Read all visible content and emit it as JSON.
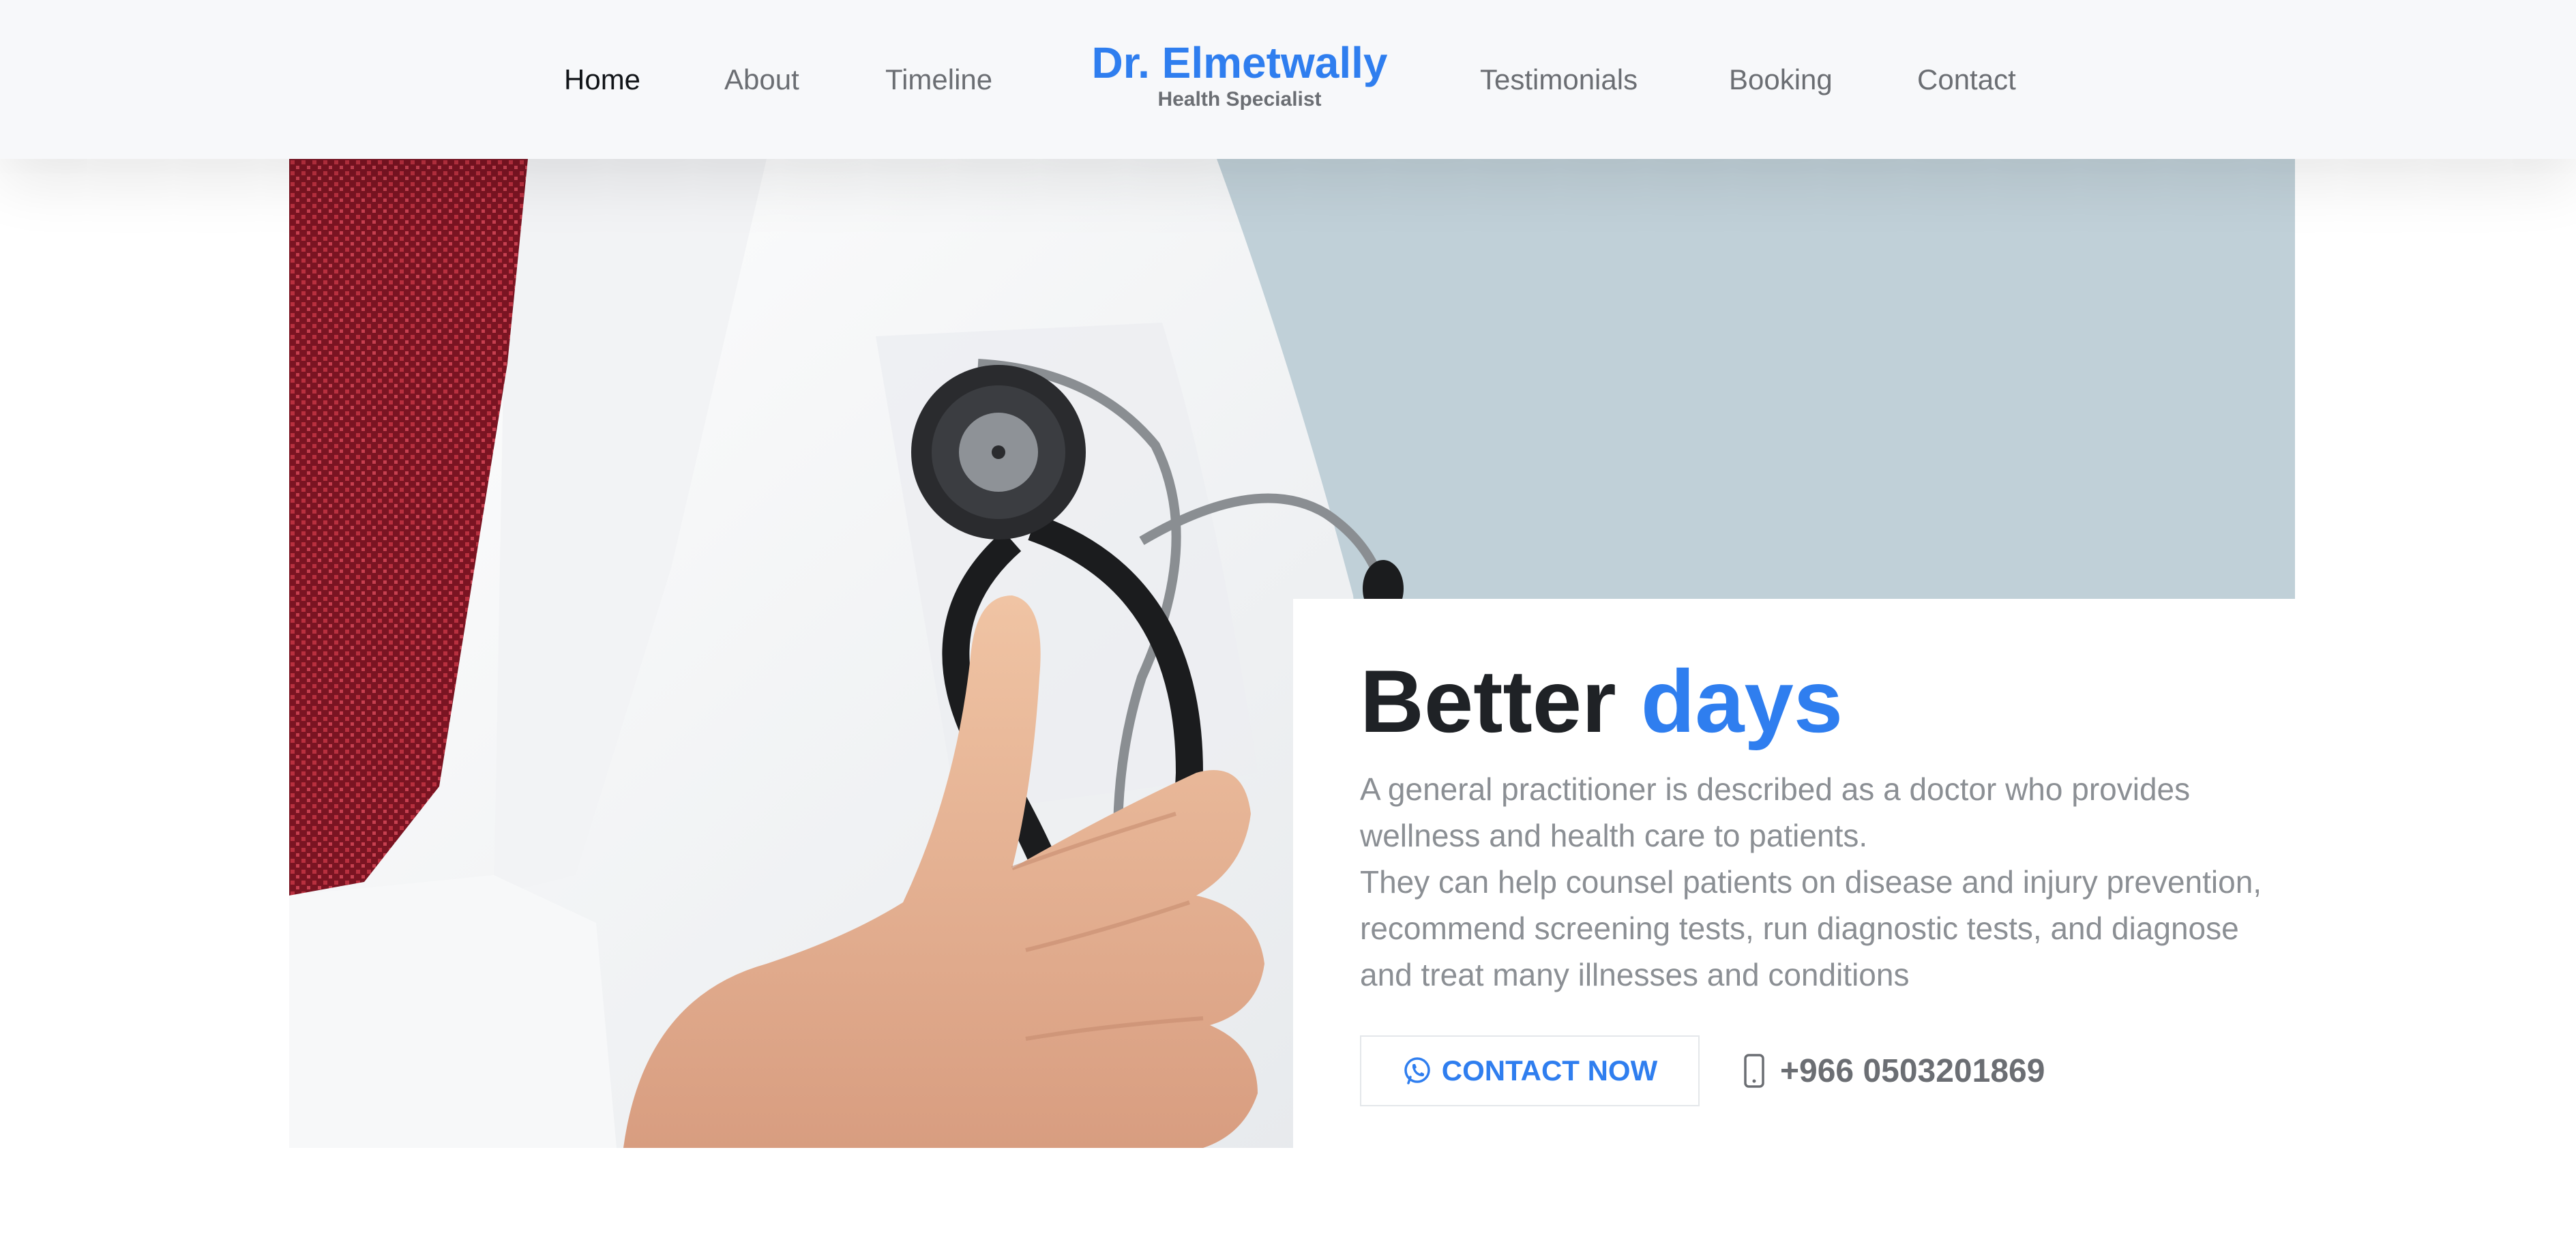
{
  "nav": {
    "left": [
      "Home",
      "About",
      "Timeline"
    ],
    "right": [
      "Testimonials",
      "Booking",
      "Contact"
    ],
    "active": "Home"
  },
  "brand": {
    "name": "Dr. Elmetwally",
    "subtitle": "Health Specialist"
  },
  "hero": {
    "heading_main": "Better",
    "heading_accent": "days",
    "paragraph_1": "A general practitioner is described as a doctor who provides wellness and health care to patients.",
    "paragraph_2": "They can help counsel patients on disease and injury prevention, recommend screening tests, run diagnostic tests, and diagnose and treat many illnesses and conditions",
    "button_label": "CONTACT NOW",
    "button_icon": "whatsapp-icon",
    "phone_icon": "mobile-phone-icon",
    "phone": "+966 0503201869"
  },
  "colors": {
    "accent": "#2f7eef",
    "heading": "#1f2226",
    "muted": "#8b8f94",
    "header_bg": "#f7f8fa",
    "hero_bg": "#c0d0d8"
  }
}
